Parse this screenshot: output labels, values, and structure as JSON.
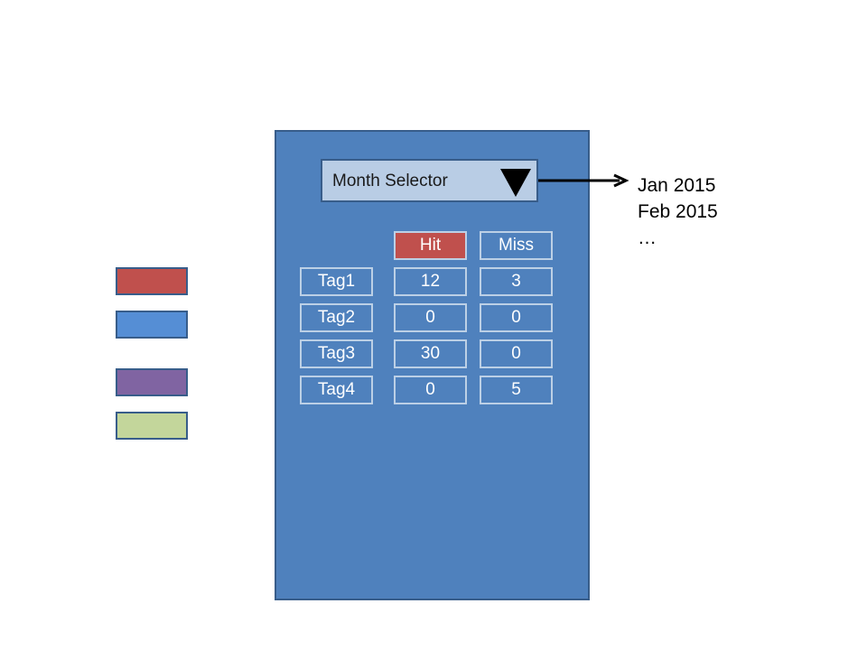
{
  "legend_swatches": [
    {
      "color": "#c0504d"
    },
    {
      "color": "#4f81bd"
    },
    {
      "color": "#8064a2"
    },
    {
      "color": "#c3d69b"
    }
  ],
  "panel": {
    "color": "#4f81bd",
    "month_selector": {
      "label": "Month Selector",
      "dropdown_icon": "triangle-down-icon"
    },
    "table": {
      "headers": [
        "Hit",
        "Miss"
      ],
      "rows": [
        {
          "tag": "Tag1",
          "hit": "12",
          "miss": "3"
        },
        {
          "tag": "Tag2",
          "hit": "0",
          "miss": "0"
        },
        {
          "tag": "Tag3",
          "hit": "30",
          "miss": "0"
        },
        {
          "tag": "Tag4",
          "hit": "0",
          "miss": "5"
        }
      ]
    }
  },
  "dropdown_options": [
    "Jan 2015",
    "Feb 2015",
    "…"
  ]
}
